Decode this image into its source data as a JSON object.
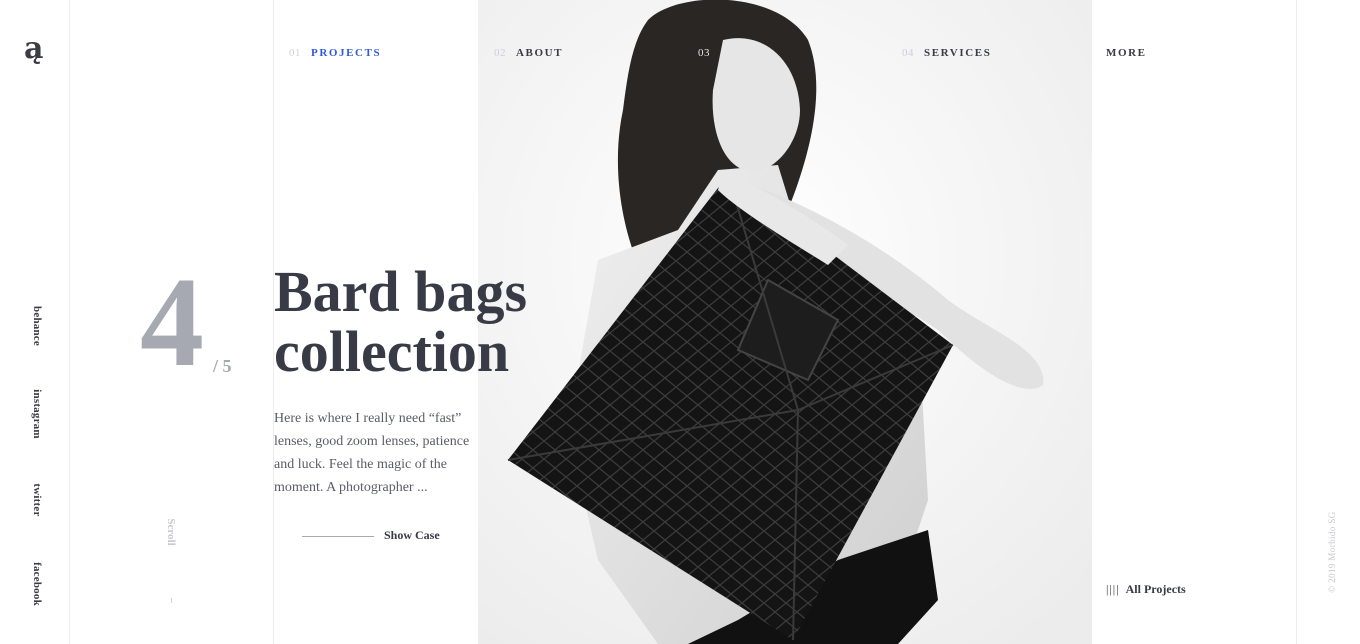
{
  "logo": {
    "text": "ą"
  },
  "social": [
    "behance",
    "instagram",
    "twitter",
    "facebook"
  ],
  "nav": [
    {
      "num": "01",
      "label": "PROJECTS",
      "active": true
    },
    {
      "num": "02",
      "label": "ABOUT"
    },
    {
      "num": "03",
      "label": ""
    },
    {
      "num": "04",
      "label": "SERVICES"
    },
    {
      "num": "",
      "label": "MORE"
    }
  ],
  "slider": {
    "current": "4",
    "total": "/ 5"
  },
  "project": {
    "title_line1": "Bard bags",
    "title_line2": "collection",
    "description": "Here is where I really need “fast” lenses, good zoom lenses, patience and luck. Feel the magic of the moment. A photographer ...",
    "cta": "Show Case"
  },
  "scroll_label": "Scroll",
  "all_projects": {
    "bars": "||||",
    "label": "All Projects"
  },
  "copyright": "© 2019 Morbido SG",
  "colors": {
    "accent": "#2f5cd6",
    "text": "#383a45",
    "muted": "#a6a8b2"
  }
}
